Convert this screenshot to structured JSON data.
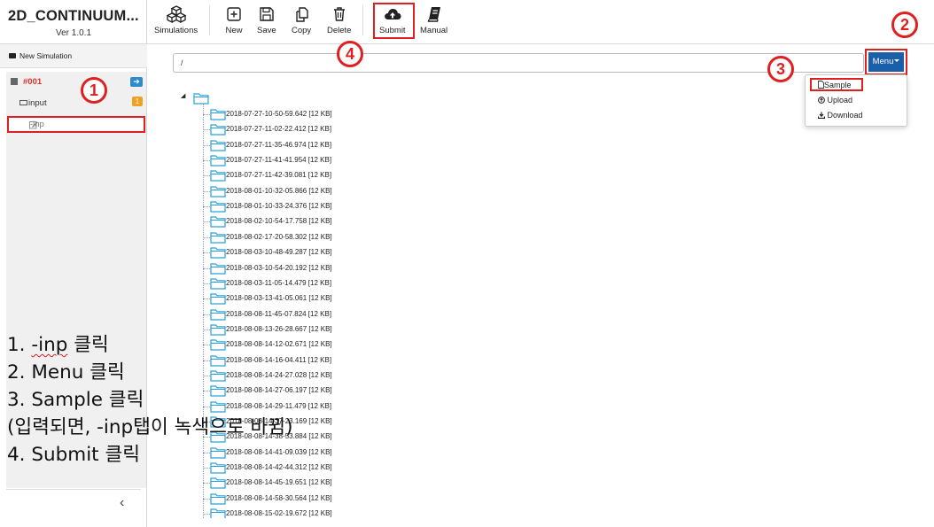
{
  "app": {
    "title": "2D_CONTINUUM...",
    "version": "Ver 1.0.1"
  },
  "toolbar": {
    "simulations": "Simulations",
    "new": "New",
    "save": "Save",
    "copy": "Copy",
    "delete": "Delete",
    "submit": "Submit",
    "manual": "Manual"
  },
  "sidebar": {
    "new_simulation": "New Simulation",
    "simulation_name": "#001",
    "arrow_badge": "➔",
    "input_label": "input",
    "input_badge": "1",
    "inp_label": "-inp",
    "collapse": "‹"
  },
  "path": {
    "value": "/"
  },
  "menu": {
    "label": "Menu",
    "items": [
      "Sample",
      "Upload",
      "Download"
    ]
  },
  "tree": {
    "items": [
      "2018-07-27-10-50-59.642 [12 KB]",
      "2018-07-27-11-02-22.412 [12 KB]",
      "2018-07-27-11-35-46.974 [12 KB]",
      "2018-07-27-11-41-41.954 [12 KB]",
      "2018-07-27-11-42-39.081 [12 KB]",
      "2018-08-01-10-32-05.866 [12 KB]",
      "2018-08-01-10-33-24.376 [12 KB]",
      "2018-08-02-10-54-17.758 [12 KB]",
      "2018-08-02-17-20-58.302 [12 KB]",
      "2018-08-03-10-48-49.287 [12 KB]",
      "2018-08-03-10-54-20.192 [12 KB]",
      "2018-08-03-11-05-14.479 [12 KB]",
      "2018-08-03-13-41-05.061 [12 KB]",
      "2018-08-08-11-45-07.824 [12 KB]",
      "2018-08-08-13-26-28.667 [12 KB]",
      "2018-08-08-14-12-02.671 [12 KB]",
      "2018-08-08-14-16-04.411 [12 KB]",
      "2018-08-08-14-24-27.028 [12 KB]",
      "2018-08-08-14-27-06.197 [12 KB]",
      "2018-08-08-14-29-11.479 [12 KB]",
      "2018-08-08-14-37-23.169 [12 KB]",
      "2018-08-08-14-38-53.884 [12 KB]",
      "2018-08-08-14-41-09.039 [12 KB]",
      "2018-08-08-14-42-44.312 [12 KB]",
      "2018-08-08-14-45-19.651 [12 KB]",
      "2018-08-08-14-58-30.564 [12 KB]",
      "2018-08-08-15-02-19.672 [12 KB]"
    ]
  },
  "instructions": {
    "line1_prefix": "1. ",
    "line1_word": "-inp",
    "line1_suffix": " 클릭",
    "line2": "2. Menu 클릭",
    "line3": "3. Sample 클릭",
    "line4": "(입력되면, -inp탭이 녹색으로 바뀜)",
    "line5": "4. Submit 클릭"
  },
  "callouts": [
    "1",
    "2",
    "3",
    "4"
  ],
  "colors": {
    "accent_red": "#e02020",
    "menu_blue": "#1a5fa8",
    "badge_blue": "#2a8ccd",
    "badge_orange": "#f0a121",
    "folder_blue": "#2aa0d8",
    "sim_red": "#d9312c"
  }
}
